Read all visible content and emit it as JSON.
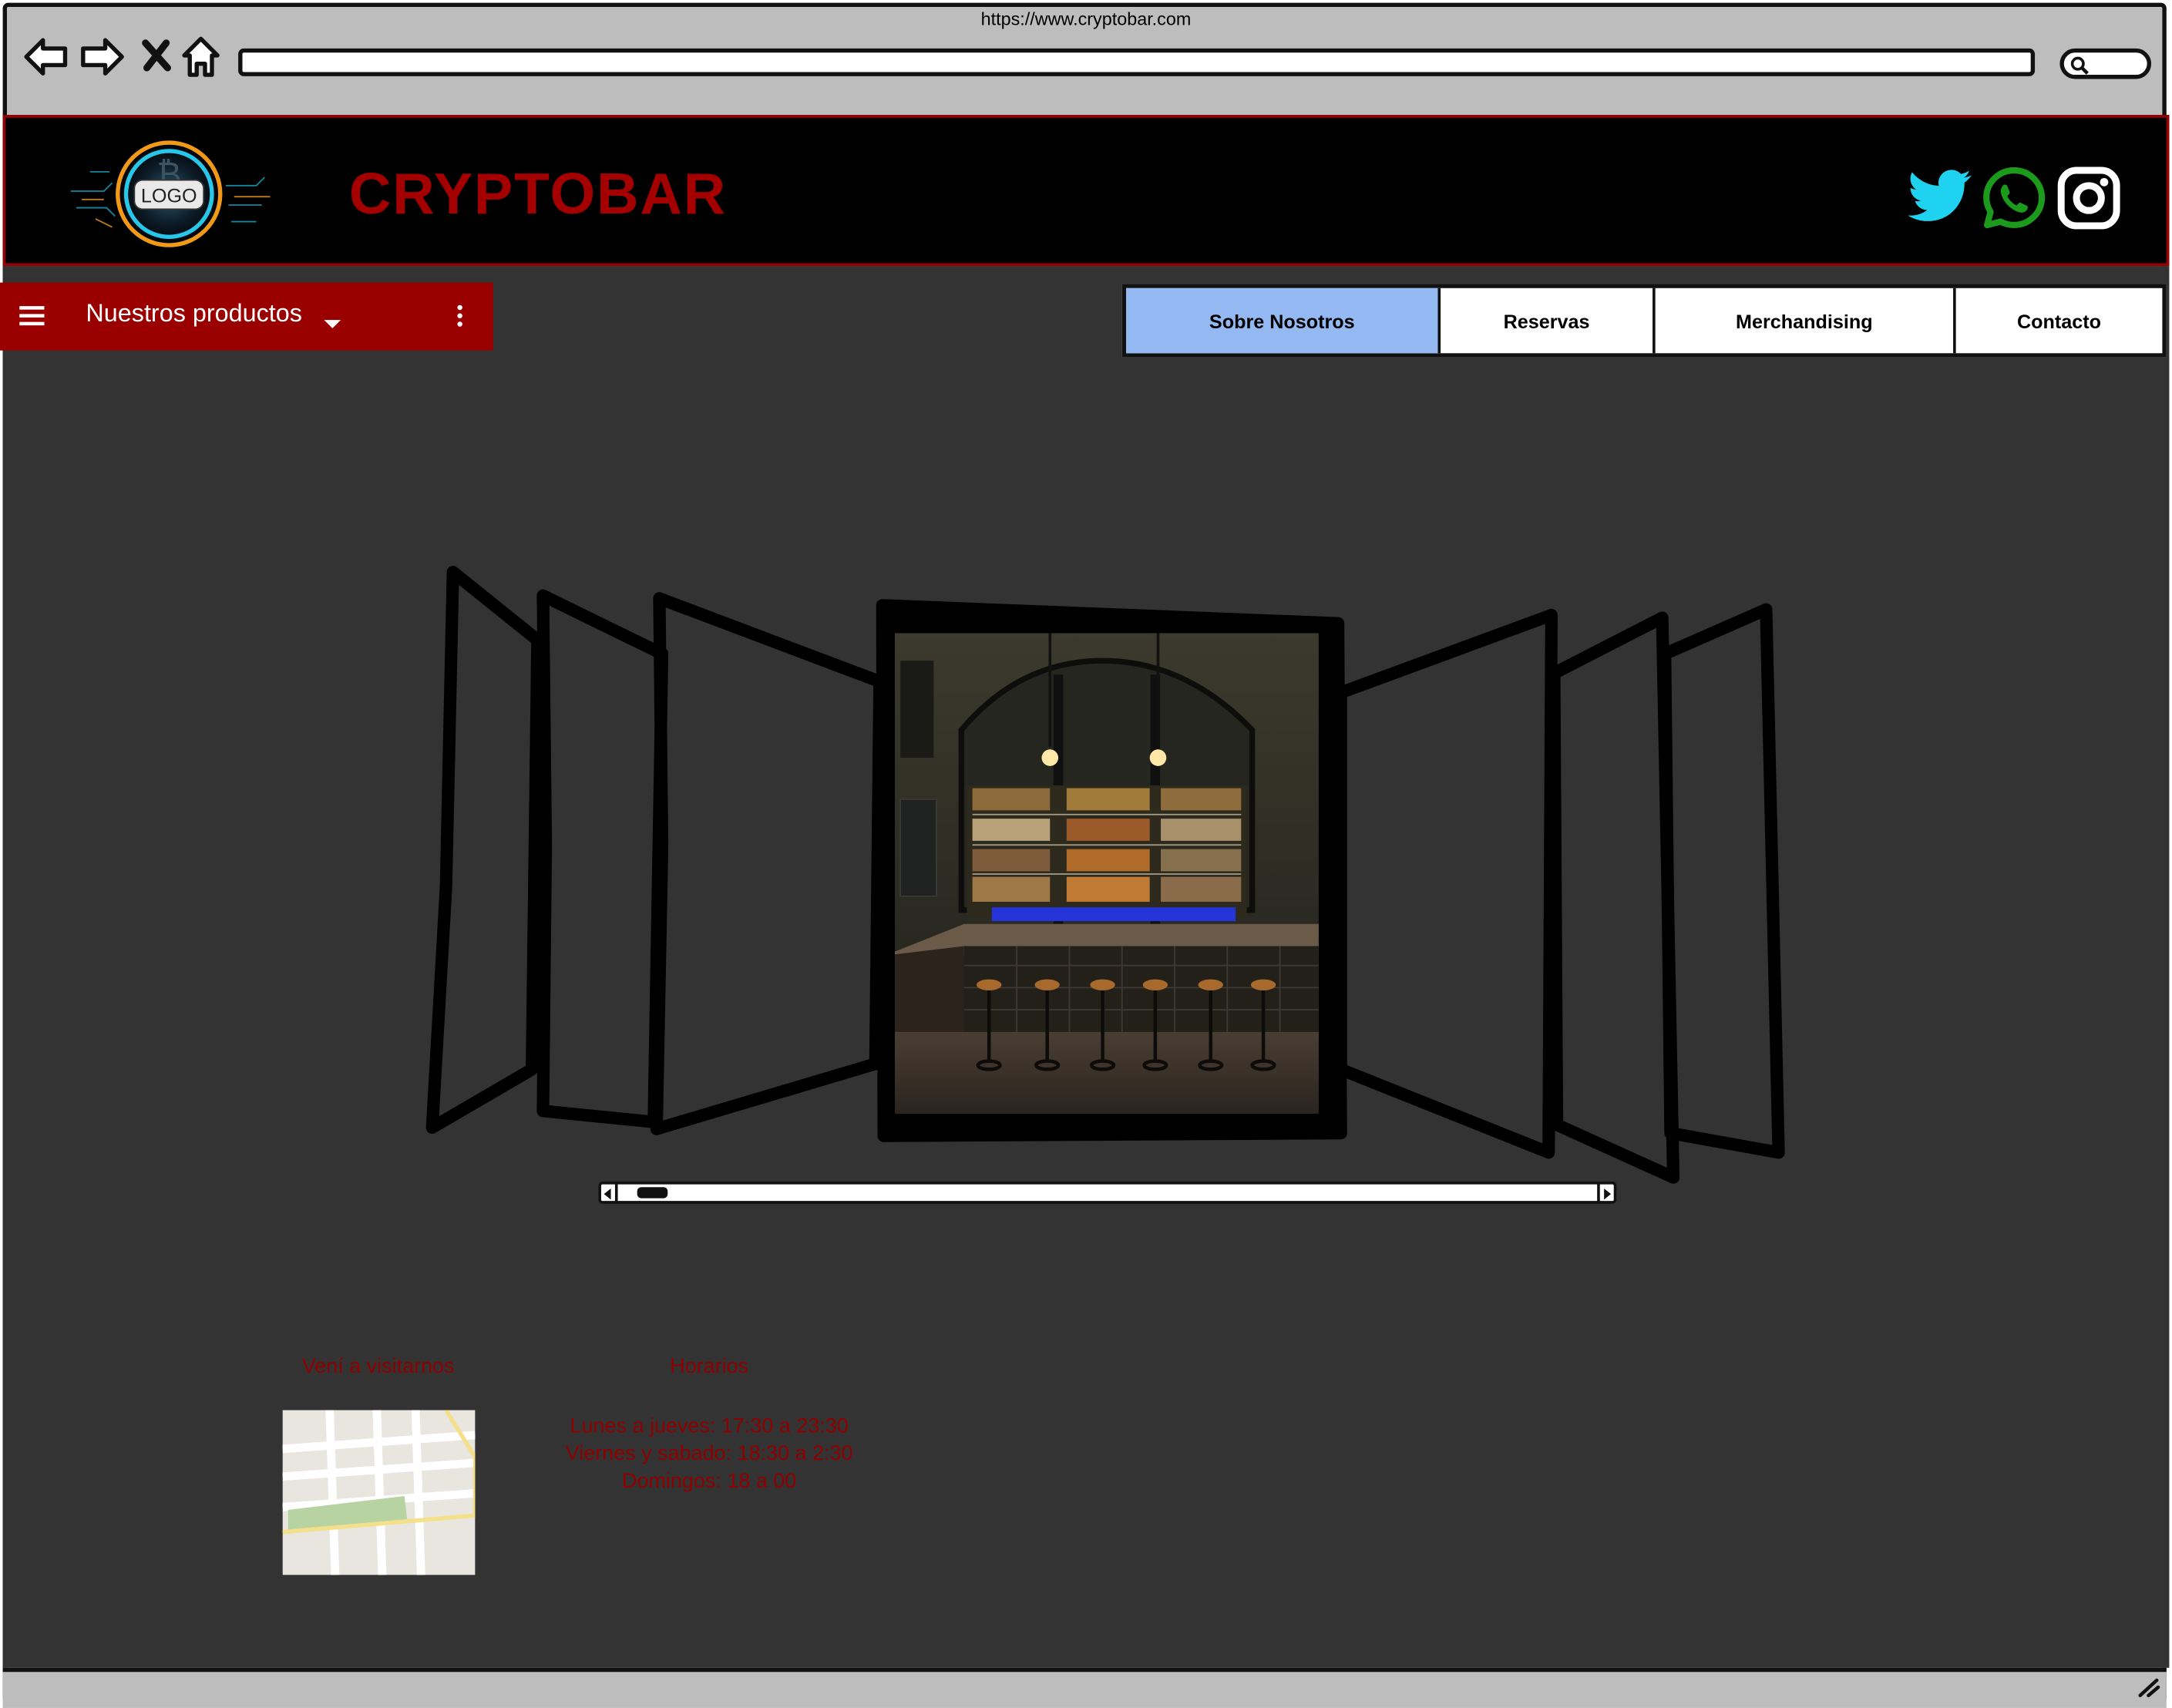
{
  "browser": {
    "url": "https://www.cryptobar.com",
    "back_icon": "back-arrow-icon",
    "forward_icon": "forward-arrow-icon",
    "stop_icon": "close-icon",
    "home_icon": "home-icon",
    "search_icon": "search-icon"
  },
  "header": {
    "logo_text": "LOGO",
    "site_title": "CRYPTOBAR",
    "social": [
      {
        "name": "twitter-icon",
        "color": "#1fd3f0"
      },
      {
        "name": "whatsapp-icon",
        "color": "#1c9a1c"
      },
      {
        "name": "instagram-icon",
        "color": "#ffffff"
      }
    ],
    "border_color": "#9a0000",
    "title_color": "#a40000"
  },
  "products_menu": {
    "label": "Nuestros productos",
    "background": "#9a0000"
  },
  "nav": {
    "tabs": [
      {
        "label": "Sobre Nosotros",
        "active": true
      },
      {
        "label": "Reservas",
        "active": false
      },
      {
        "label": "Merchandising",
        "active": false
      },
      {
        "label": "Contacto",
        "active": false
      }
    ],
    "active_color": "#94b8f2"
  },
  "carousel": {
    "image_alt": "Interior de bar con estantes de botellas y taburetes",
    "scroll_position": 0.02
  },
  "visit": {
    "heading": "Vení a visitarnos"
  },
  "hours": {
    "heading": "Horarios",
    "lines": [
      "Lunes a jueves: 17:30 a 23:30",
      "Viernes y sabado: 18:30 a 2:30",
      "Domingos: 18 a 00"
    ]
  },
  "colors": {
    "page_background": "#333333",
    "info_text": "#8f0000"
  }
}
